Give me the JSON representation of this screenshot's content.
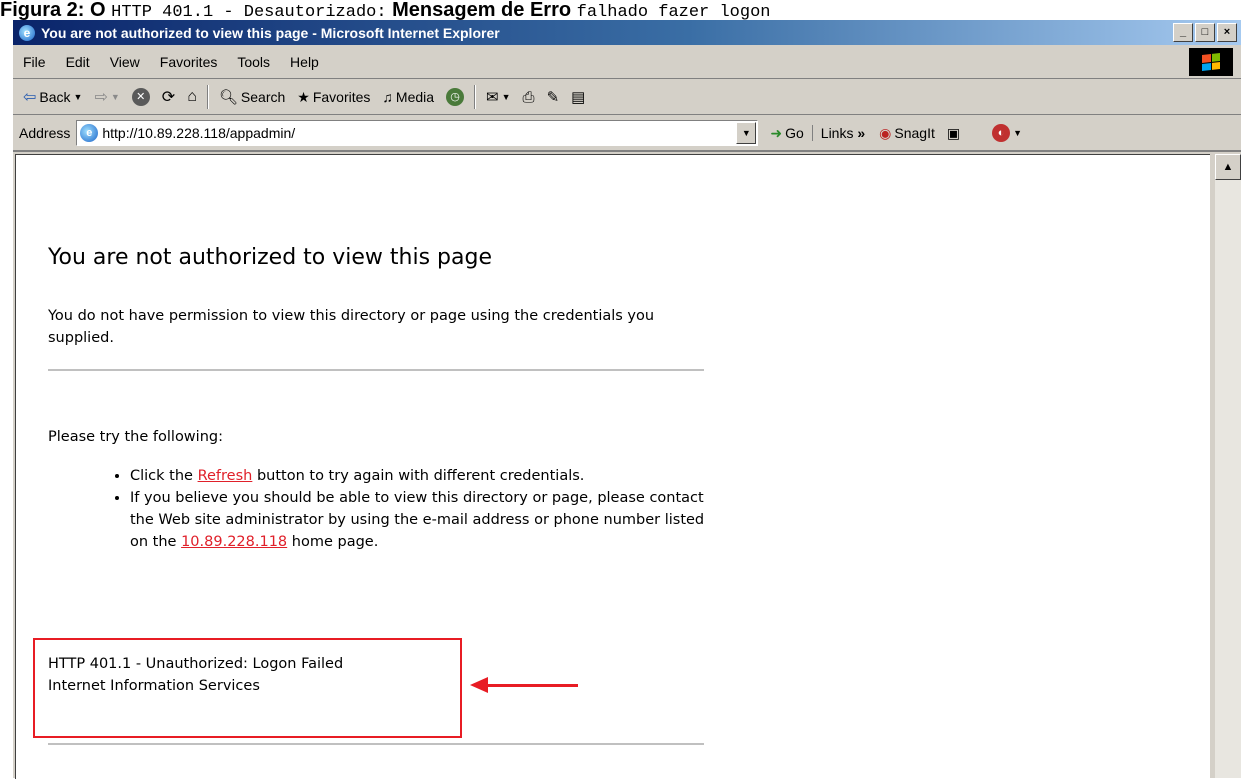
{
  "caption": {
    "prefix": "Figura 2: O ",
    "code1": "HTTP 401.1 - Desautorizado:",
    "middle": " Mensagem de Erro ",
    "code2": "falhado fazer logon"
  },
  "window": {
    "title": "You are not authorized to view this page - Microsoft Internet Explorer",
    "buttons": {
      "minimize": "_",
      "maximize": "□",
      "close": "×"
    }
  },
  "menu": {
    "items": [
      "File",
      "Edit",
      "View",
      "Favorites",
      "Tools",
      "Help"
    ]
  },
  "toolbar": {
    "back": "Back",
    "search": "Search",
    "favorites": "Favorites",
    "media": "Media"
  },
  "address": {
    "label": "Address",
    "url": "http://10.89.228.118/appadmin/",
    "go": "Go",
    "links": "Links",
    "snagit": "SnagIt"
  },
  "page": {
    "heading": "You are not authorized to view this page",
    "intro": "You do not have permission to view this directory or page using the credentials you supplied.",
    "try_label": "Please try the following:",
    "item1_pre": "Click the ",
    "item1_link": "Refresh",
    "item1_post": " button to try again with different credentials.",
    "item2_pre": "If you believe you should be able to view this directory or page, please contact the Web site administrator by using the e-mail address or phone number listed on the ",
    "item2_link": "10.89.228.118",
    "item2_post": " home page.",
    "status_line1": "HTTP 401.1 - Unauthorized: Logon Failed",
    "status_line2": "Internet Information Services"
  },
  "colors": {
    "annotation": "#e81c24",
    "titlebar": "#0a246a",
    "link": "#e0202a"
  }
}
